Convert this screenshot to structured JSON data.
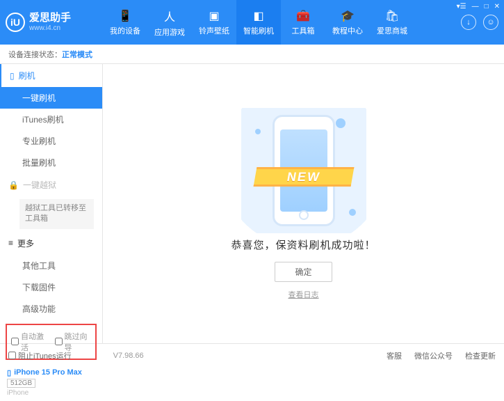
{
  "header": {
    "app_name": "爱思助手",
    "app_url": "www.i4.cn",
    "nav": [
      {
        "label": "我的设备"
      },
      {
        "label": "应用游戏"
      },
      {
        "label": "铃声壁纸"
      },
      {
        "label": "智能刷机"
      },
      {
        "label": "工具箱"
      },
      {
        "label": "教程中心"
      },
      {
        "label": "爱思商城"
      }
    ]
  },
  "status": {
    "prefix": "设备连接状态：",
    "mode": "正常模式"
  },
  "sidebar": {
    "flash_header": "刷机",
    "flash_items": [
      {
        "label": "一键刷机"
      },
      {
        "label": "iTunes刷机"
      },
      {
        "label": "专业刷机"
      },
      {
        "label": "批量刷机"
      }
    ],
    "jailbreak_header": "一键越狱",
    "jailbreak_note": "越狱工具已转移至工具箱",
    "more_header": "更多",
    "more_items": [
      {
        "label": "其他工具"
      },
      {
        "label": "下载固件"
      },
      {
        "label": "高级功能"
      }
    ],
    "checkboxes": {
      "auto_activate": "自动激活",
      "skip_guide": "跳过向导"
    },
    "device": {
      "name": "iPhone 15 Pro Max",
      "storage": "512GB",
      "type": "iPhone"
    }
  },
  "main": {
    "banner": "NEW",
    "message": "恭喜您，保资料刷机成功啦！",
    "ok": "确定",
    "log_link": "查看日志"
  },
  "footer": {
    "block_itunes": "阻止iTunes运行",
    "version": "V7.98.66",
    "links": {
      "service": "客服",
      "wechat": "微信公众号",
      "update": "检查更新"
    }
  }
}
